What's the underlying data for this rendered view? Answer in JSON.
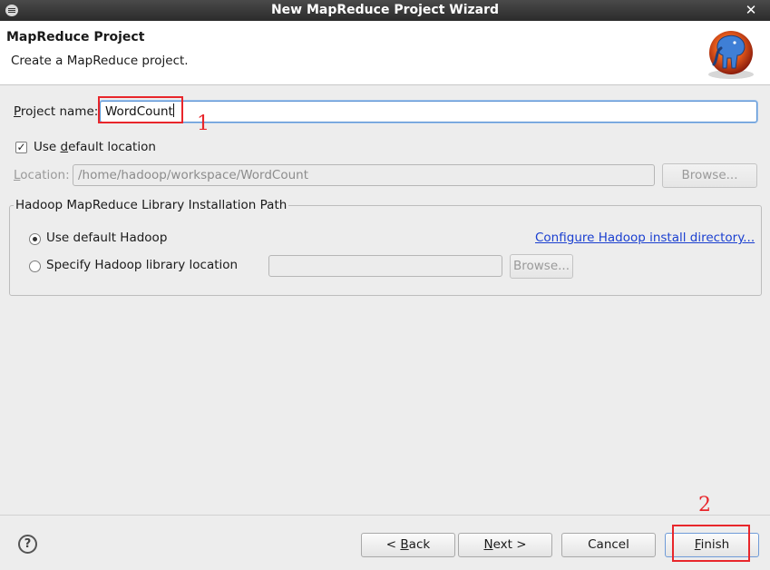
{
  "window": {
    "title": "New MapReduce Project Wizard",
    "close_glyph": "✕",
    "menu_icon": "window-menu-icon"
  },
  "header": {
    "title": "MapReduce Project",
    "description": "Create a MapReduce project.",
    "logo_icon": "hadoop-elephant-logo"
  },
  "project": {
    "name_label_prefix": "P",
    "name_label_rest": "roject name:",
    "name_value": "WordCount",
    "use_default_location_pre": "Use ",
    "use_default_location_u": "d",
    "use_default_location_post": "efault location",
    "use_default_location_checked": true,
    "location_label_u": "L",
    "location_label_rest": "ocation:",
    "location_value": "/home/hadoop/workspace/WordCount",
    "browse_label": "Browse..."
  },
  "hadoop_group": {
    "title": "Hadoop MapReduce Library Installation Path",
    "use_default_label": "Use default Hadoop",
    "use_default_selected": true,
    "configure_link": "Configure Hadoop install directory...",
    "specify_label": "Specify Hadoop library location",
    "specify_path_value": "",
    "browse_label": "Browse..."
  },
  "annotations": {
    "marker_1": "1",
    "marker_2": "2",
    "color": "#e8262b"
  },
  "footer": {
    "help_glyph": "?",
    "back_pre": "< ",
    "back_u": "B",
    "back_post": "ack",
    "next_u": "N",
    "next_post": "ext >",
    "cancel_label": "Cancel",
    "finish_u": "F",
    "finish_post": "inish"
  }
}
